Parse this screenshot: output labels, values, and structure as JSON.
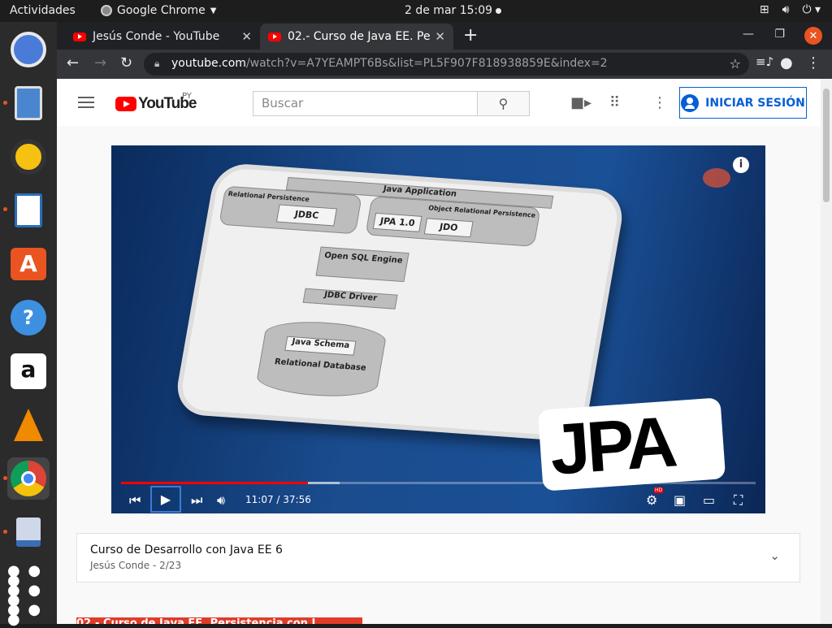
{
  "os": {
    "activities": "Actividades",
    "app_name": "Google Chrome",
    "clock": "2 de mar  15:09"
  },
  "tabs": [
    {
      "title": "Jesús Conde - YouTube"
    },
    {
      "title": "02.- Curso de Java EE. Per"
    }
  ],
  "address": {
    "host": "youtube.com",
    "path": "/watch?v=A7YEAMPT6Bs&list=PL5F907F818938859E&index=2"
  },
  "yt": {
    "logo_text": "YouTube",
    "country": "PY",
    "search_placeholder": "Buscar",
    "signin_label": "INICIAR SESIÓN"
  },
  "video": {
    "diagram": {
      "app": "Java Application",
      "relational": "Relational Persistence",
      "object": "Object Relational Persistence",
      "jdbc": "JDBC",
      "jpa": "JPA 1.0",
      "jdo": "JDO",
      "engine": "Open SQL Engine",
      "driver": "JDBC Driver",
      "schema": "Java Schema",
      "database": "Relational Database"
    },
    "overlay": "JPA",
    "time": "11:07 / 37:56",
    "progress_played": 0.295,
    "progress_loaded": 0.345,
    "hd": "HD"
  },
  "playlist": {
    "title": "Curso de Desarrollo con Java EE 6",
    "subtitle": "Jesús Conde - 2/23"
  },
  "video_title_partial": "02.- Curso de Java EE. Persistencia con J"
}
